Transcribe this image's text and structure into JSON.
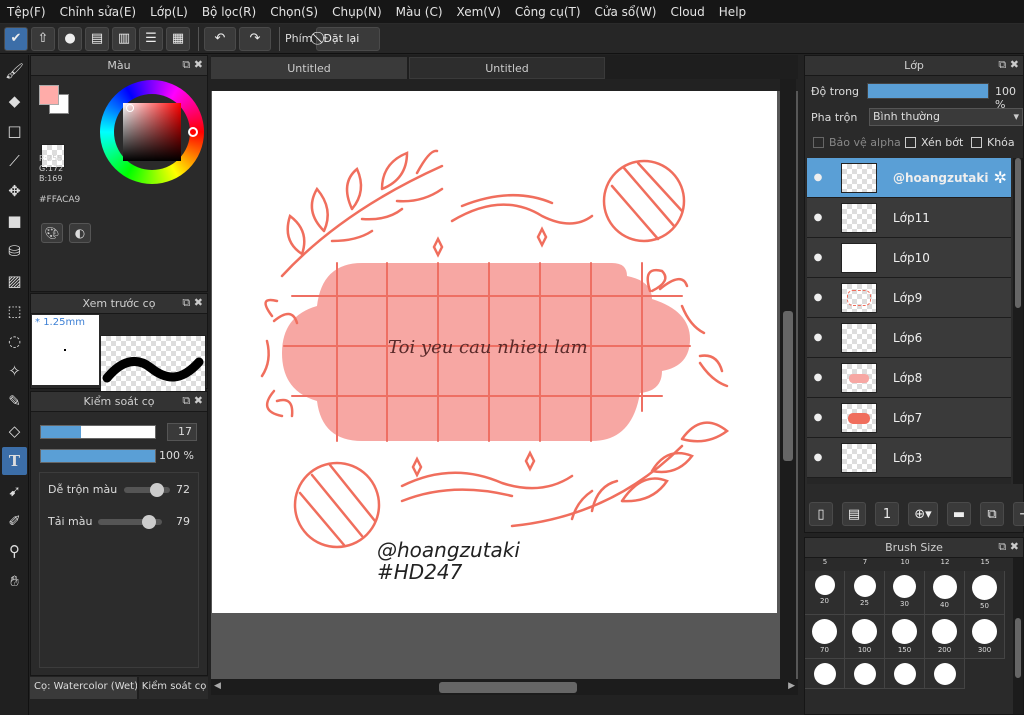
{
  "menu": [
    "Tệp(F)",
    "Chỉnh sửa(E)",
    "Lớp(L)",
    "Bộ lọc(R)",
    "Chọn(S)",
    "Chụp(N)",
    "Màu (C)",
    "Xem(V)",
    "Công cụ(T)",
    "Cửa sổ(W)",
    "Cloud",
    "Help"
  ],
  "toolbar": {
    "key_label": "Phím",
    "reset_label": "Đặt lại"
  },
  "color_panel": {
    "title": "Màu",
    "r": "R:255",
    "g": "G:172",
    "b": "B:169",
    "hex": "#FFACA9",
    "fg": "#ffaca9"
  },
  "brush_preview": {
    "title": "Xem trước cọ",
    "size": "1.25mm"
  },
  "brush_control": {
    "title": "Kiểm soát cọ",
    "size_value": "17",
    "opacity_value": "100 %",
    "blend_label": "Dễ trộn màu",
    "blend_value": "72",
    "load_label": "Tải màu",
    "load_value": "79",
    "size_fraction": 0.35,
    "opacity_fraction": 1.0,
    "blend_fraction": 0.72,
    "load_fraction": 0.79
  },
  "bottom_tabs": [
    "Cọ: Watercolor (Wet)",
    "Kiểm soát cọ"
  ],
  "doc_tabs": [
    "Untitled",
    "Untitled"
  ],
  "canvas": {
    "banner_text": "Toi yeu cau nhieu lam",
    "credit1": "@hoangzutaki",
    "credit2": "#HD247",
    "accent": "#f06e5d",
    "banner_color": "#f7a7a3"
  },
  "layers": {
    "title": "Lớp",
    "opacity_label": "Độ trong",
    "opacity_value": "100 %",
    "blend_label": "Pha trộn",
    "blend_value": "Bình thường",
    "alpha_label": "Bảo vệ alpha",
    "clip_label": "Xén bớt",
    "lock_label": "Khóa",
    "items": [
      {
        "name": "@hoangzutaki",
        "selected": true
      },
      {
        "name": "Lớp11"
      },
      {
        "name": "Lớp10"
      },
      {
        "name": "Lớp9"
      },
      {
        "name": "Lớp6"
      },
      {
        "name": "Lớp8"
      },
      {
        "name": "Lớp7"
      },
      {
        "name": "Lớp3"
      }
    ]
  },
  "brush_size": {
    "title": "Brush Size",
    "top_row": [
      "5",
      "7",
      "10",
      "12",
      "15"
    ],
    "rows": [
      [
        "20",
        "25",
        "30",
        "40",
        "50"
      ],
      [
        "70",
        "100",
        "150",
        "200",
        "300"
      ]
    ]
  }
}
